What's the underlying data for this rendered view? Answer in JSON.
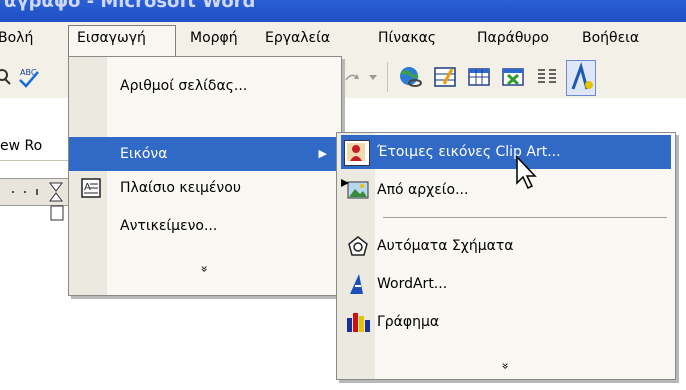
{
  "window": {
    "title": "αγραφο - Microsoft Word"
  },
  "menubar": {
    "items": [
      {
        "label": "Βολή"
      },
      {
        "label": "Εισαγωγή"
      },
      {
        "label": "Μορφή"
      },
      {
        "label": "Εργαλεία"
      },
      {
        "label": "Πίνακας"
      },
      {
        "label": "Παράθυρο"
      },
      {
        "label": "Βοήθεια"
      }
    ]
  },
  "toolbar": {
    "font_name": "ew Ro"
  },
  "insert_menu": {
    "items": [
      {
        "label": "Αριθμοί σελίδας..."
      },
      {
        "label": "Εικόνα",
        "highlighted": true
      },
      {
        "label": "Πλαίσιο κειμένου"
      },
      {
        "label": "Αντικείμενο..."
      }
    ],
    "expand_glyph": "»"
  },
  "picture_submenu": {
    "items": [
      {
        "label": "Έτοιμες εικόνες Clip Art...",
        "highlighted": true
      },
      {
        "label": "Από αρχείο..."
      },
      {
        "label": "Αυτόματα Σχήματα"
      },
      {
        "label": "WordArt..."
      },
      {
        "label": "Γράφημα"
      }
    ],
    "expand_glyph": "»"
  },
  "colors": {
    "highlight": "#3169c6",
    "menu_bg": "#f9f8f3",
    "titlebar": "#1f4fc2"
  }
}
